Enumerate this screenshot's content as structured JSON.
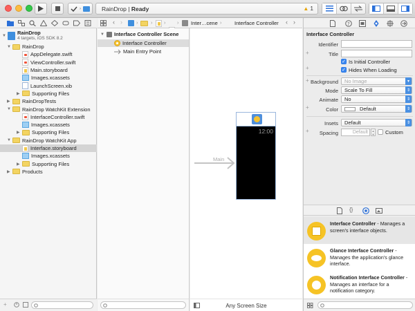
{
  "toolbar": {
    "status_app": "RainDrop",
    "status_sep": " | ",
    "status_state": "Ready",
    "warning_count": "1"
  },
  "navigator": {
    "project": {
      "name": "RainDrop",
      "subtitle": "4 targets, iOS SDK 8.2"
    },
    "items": [
      {
        "label": "RainDrop",
        "kind": "folder",
        "indent": 1,
        "expanded": true
      },
      {
        "label": "AppDelegate.swift",
        "kind": "swift",
        "indent": 2
      },
      {
        "label": "ViewController.swift",
        "kind": "swift",
        "indent": 2
      },
      {
        "label": "Main.storyboard",
        "kind": "storyboard",
        "indent": 2
      },
      {
        "label": "Images.xcassets",
        "kind": "xcassets",
        "indent": 2
      },
      {
        "label": "LaunchScreen.xib",
        "kind": "xib",
        "indent": 2
      },
      {
        "label": "Supporting Files",
        "kind": "folder",
        "indent": 2,
        "expanded": false
      },
      {
        "label": "RainDropTests",
        "kind": "folder",
        "indent": 1,
        "expanded": false
      },
      {
        "label": "RainDrop WatchKit Extension",
        "kind": "folder",
        "indent": 1,
        "expanded": true
      },
      {
        "label": "InterfaceController.swift",
        "kind": "swift",
        "indent": 2
      },
      {
        "label": "Images.xcassets",
        "kind": "xcassets",
        "indent": 2
      },
      {
        "label": "Supporting Files",
        "kind": "folder",
        "indent": 2,
        "expanded": false
      },
      {
        "label": "RainDrop WatchKit App",
        "kind": "folder",
        "indent": 1,
        "expanded": true
      },
      {
        "label": "Interface.storyboard",
        "kind": "storyboard",
        "indent": 2,
        "selected": true
      },
      {
        "label": "Images.xcassets",
        "kind": "xcassets",
        "indent": 2
      },
      {
        "label": "Supporting Files",
        "kind": "folder",
        "indent": 2,
        "expanded": false
      },
      {
        "label": "Products",
        "kind": "folder",
        "indent": 1,
        "expanded": false
      }
    ]
  },
  "jumpbar": {
    "crumb_file": "Inter…cene",
    "crumb_item": "Interface Controller"
  },
  "outline": {
    "scene": "Interface Controller Scene",
    "controller": "Interface Controller",
    "entry": "Main Entry Point"
  },
  "canvas": {
    "segue_label": "Main",
    "watch_time": "12:00",
    "size_class": "Any Screen Size"
  },
  "inspector": {
    "header": "Interface Controller",
    "identifier_label": "Identifier",
    "identifier_value": "",
    "title_label": "Title",
    "title_value": "",
    "initial_controller": "Is Initial Controller",
    "hides_loading": "Hides When Loading",
    "background_label": "Background",
    "background_placeholder": "No Image",
    "mode_label": "Mode",
    "mode_value": "Scale To Fill",
    "animate_label": "Animate",
    "animate_value": "No",
    "color_label": "Color",
    "color_value": "Default",
    "insets_label": "Insets",
    "insets_value": "Default",
    "spacing_label": "Spacing",
    "spacing_placeholder": "Default",
    "custom_label": "Custom",
    "initial_checked": true,
    "hides_checked": true,
    "custom_checked": false
  },
  "library": {
    "items": [
      {
        "title": "Interface Controller",
        "desc": " - Manages a screen's interface objects.",
        "selected": true
      },
      {
        "title": "Glance Interface Controller",
        "desc": " - Manages the application's glance interface."
      },
      {
        "title": "Notification Interface Controller",
        "desc": " - Manages an interface for a notification category."
      }
    ]
  },
  "colors": {
    "accent": "#3b87ef",
    "folder": "#f3d462",
    "watch_icon": "#f6c325",
    "status_ready_text": "#333333"
  }
}
